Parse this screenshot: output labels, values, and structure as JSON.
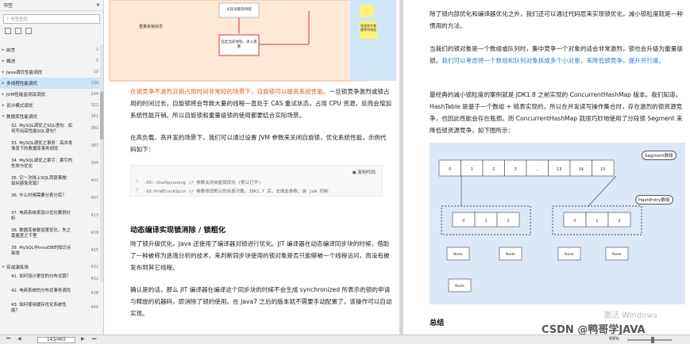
{
  "sidebar": {
    "title": "书签",
    "search_placeholder": "书签查找",
    "items": [
      {
        "arrow": "▸",
        "label": "前言",
        "page": "1"
      },
      {
        "arrow": "▸",
        "label": "概述",
        "page": "5"
      },
      {
        "arrow": "▸",
        "label": "Java调优性能调优",
        "page": "10"
      },
      {
        "arrow": "▸",
        "label": "多线程性能调优",
        "page": "130",
        "selected": true
      },
      {
        "arrow": "▸",
        "label": "JVM性能监测及调优",
        "page": "244"
      },
      {
        "arrow": "▸",
        "label": "设计模式调优",
        "page": "322"
      },
      {
        "arrow": "▾",
        "label": "数据库性能调优",
        "page": "381"
      }
    ],
    "subitems": [
      {
        "label": "32. MySQL调优之SQL语句：如何写出高性能SQL语句？",
        "page": "381"
      },
      {
        "label": "33. MySQL调优之事务：高并发场景下的数据库事务调优",
        "page": "387"
      },
      {
        "label": "34. MySQL调优之索引：索引的失效与优化",
        "page": "395"
      },
      {
        "label": "35. 记一次线上SQL死锁事故：如何避免死锁？",
        "page": "401"
      },
      {
        "label": "36. 什么时候需要分表分库？",
        "page": "407"
      },
      {
        "label": "37. 电商系统表设计优化案例分析",
        "page": "413"
      },
      {
        "label": "38. 数据库参数设置优化，失之毫厘差之千里",
        "page": "419"
      },
      {
        "label": "39. MySQL中InnoDB的知识点串烧",
        "page": "425"
      }
    ],
    "bottom_items": [
      {
        "arrow": "▾",
        "label": "实战演练场",
        "page": "432"
      },
      {
        "label": "41. 如何设计更优的分布式锁？",
        "page": "432"
      },
      {
        "label": "42. 电商系统的分布式事务调优",
        "page": "438"
      },
      {
        "label": "43. 如何使用缓存优化系统性能？",
        "page": "445"
      }
    ]
  },
  "page1": {
    "diagram": {
      "box1": "长轮询量等待锁",
      "box2": "挂起当前线程，进入阻塞",
      "left_label": "重量级锁状态",
      "right_label": "释放锁并唤醒等待线程"
    },
    "para1_orange": "在锁竞争不激烈且锁占用时间非常短的场景下，自旋锁可以提高系统性能。",
    "para1_rest": "一旦锁竞争激烈或锁占用的时间过长，自旋锁将会导致大量的线程一直处于 CAS 重试状态，占用 CPU 资源，反而会增加系统性能开销。所以自旋锁和重量级锁的使用都要结合实际场景。",
    "para2": "在高负载、高并发的场景下，我们可以通过设置 JVM 参数来关闭自旋锁，优化系统性能，示例代码如下：",
    "code_copy": "复制代码",
    "code_lines": [
      "-XX:-UseSpinning // 参数关闭自旋锁优化 (默认打开)",
      "-XX:PreBlockSpin // 参数修改默认的自旋次数。JDK1.7 后，去掉此参数，由 jvm 控制"
    ],
    "code_nums": [
      "1",
      "2"
    ],
    "heading": "动态编译实现锁消除 / 锁粗化",
    "para3": "除了锁升级优化，Java 还使用了编译器对锁进行优化。JIT 编译器在动态编译同步块的时候，借助了一种被称为逃逸分析的技术，来判断同步块使用的锁对象是否只能够被一个线程访问，而没有被发布到其它线程。",
    "para4": "确认是的话，那么 JIT 编译器在编译这个同步块的时候不会生成 synchronized 所表示的锁的申请与释放的机器码，即消除了锁的使用。在 Java7 之后的版本就不需要手动配置了，该操作可以自动实现。"
  },
  "page2": {
    "para1": "除了锁内部优化和编译器优化之外，我们还可以通过代码层来实现锁优化，减小锁粒度就是一种惯用的方法。",
    "para2_a": "当我们的锁对象是一个数组或队列时，集中竞争一个对象的话会非常激烈，锁也会升级为重量级锁。",
    "para2_blue": "我们可以考虑将一个数组和队列对象拆成多个小对象，来降低锁竞争，提升并行度。",
    "para3": "最经典的减小锁粒度的案例就是 JDK1.8 之前实现的 ConcurrentHashMap 版本。我们知道，HashTable 是基于一个数组 + 链表实现的，所以在并发读写操作集合时，存在激烈的锁资源竞争，也因此性能会存在瓶颈。而 ConcurrentHashMap 就很巧妙地使用了分段锁 Segment 来降低锁资源竞争，如下图所示：",
    "diagram": {
      "segment_label": "Segment数组",
      "entry_label": "HashEntry数组",
      "seg_cells": [
        "0",
        "1",
        "2",
        "3",
        "...",
        "13",
        "14",
        "15"
      ],
      "entry_cells": [
        "0",
        "1",
        "2"
      ],
      "node": "Node"
    },
    "heading": "总结"
  },
  "statusbar": {
    "page_indicator": "143/465",
    "zoom": "99%"
  },
  "watermark": {
    "windows": "激活 Windows",
    "csdn": "CSDN @鸭哥学JAVA"
  },
  "colors": {
    "orange": "#e0621c",
    "blue": "#2f7bd6",
    "selected": "#cde3f7"
  }
}
